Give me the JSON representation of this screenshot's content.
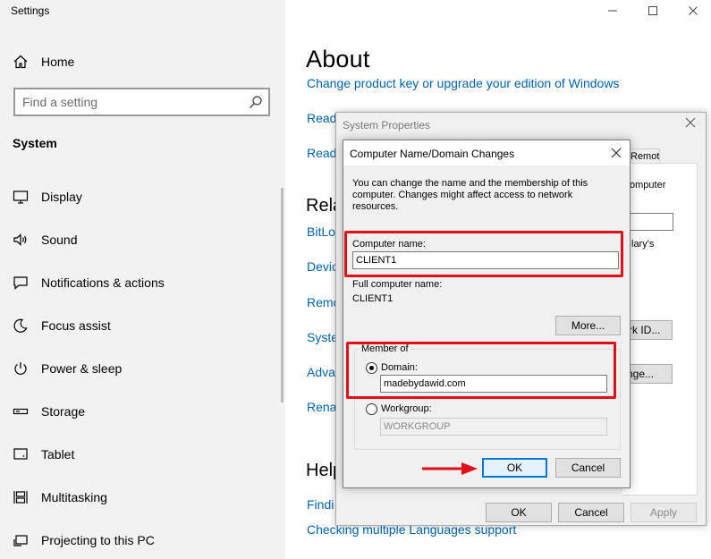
{
  "app_title": "Settings",
  "sidebar": {
    "home_label": "Home",
    "search_placeholder": "Find a setting",
    "section_title": "System",
    "items": [
      {
        "label": "Display",
        "icon": "display-icon"
      },
      {
        "label": "Sound",
        "icon": "sound-icon"
      },
      {
        "label": "Notifications & actions",
        "icon": "notifications-icon"
      },
      {
        "label": "Focus assist",
        "icon": "focus-assist-icon"
      },
      {
        "label": "Power & sleep",
        "icon": "power-icon"
      },
      {
        "label": "Storage",
        "icon": "storage-icon"
      },
      {
        "label": "Tablet",
        "icon": "tablet-icon"
      },
      {
        "label": "Multitasking",
        "icon": "multitasking-icon"
      },
      {
        "label": "Projecting to this PC",
        "icon": "projecting-icon"
      }
    ]
  },
  "about": {
    "title": "About",
    "links_top": [
      "Change product key or upgrade your edition of Windows",
      "Read",
      "Read"
    ],
    "related_heading": "Rela",
    "related_links": [
      "BitLo",
      "Devic",
      "Remo",
      "Syste",
      "Adva",
      "Renar"
    ],
    "help_heading": "Help",
    "help_links": [
      "Findi",
      "Checking multiple Languages support"
    ]
  },
  "system_properties": {
    "title": "System Properties",
    "tab_partial": "Remote",
    "text_computer": "omputer",
    "text_users": "lary's",
    "network_id_button": "rk ID...",
    "change_button": "nge...",
    "ok_label": "OK",
    "cancel_label": "Cancel",
    "apply_label": "Apply"
  },
  "dialog": {
    "title": "Computer Name/Domain Changes",
    "description": "You can change the name and the membership of this computer. Changes might affect access to network resources.",
    "computer_name_label": "Computer name:",
    "computer_name_value": "CLIENT1",
    "full_name_label": "Full computer name:",
    "full_name_value": "CLIENT1",
    "more_button": "More...",
    "member_of_label": "Member of",
    "domain_label": "Domain:",
    "domain_value": "madebydawid.com",
    "workgroup_label": "Workgroup:",
    "workgroup_value": "WORKGROUP",
    "ok_label": "OK",
    "cancel_label": "Cancel",
    "selected_membership": "Domain"
  },
  "annotation": {
    "highlight_color": "#e0101b",
    "arrow_color": "#e0101b"
  }
}
